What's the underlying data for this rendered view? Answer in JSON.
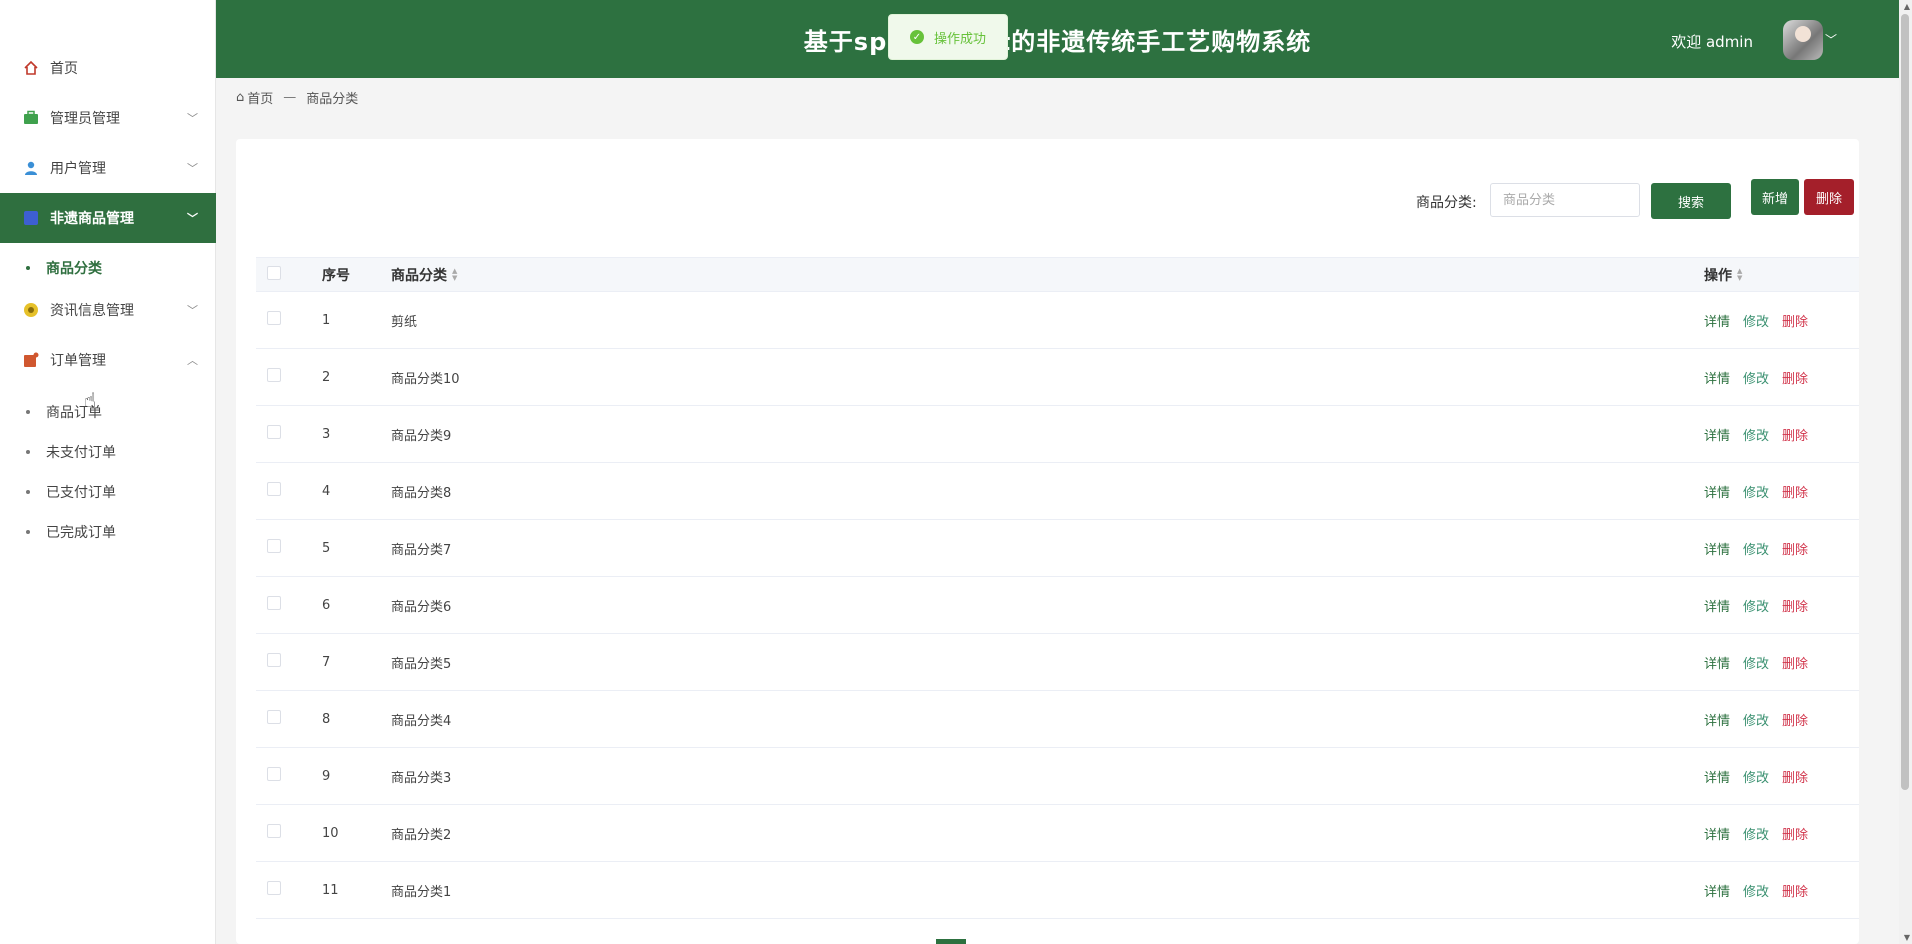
{
  "header": {
    "title": "基于springboot的非遗传统手工艺购物系统",
    "welcome": "欢迎 admin"
  },
  "toast": {
    "message": "操作成功"
  },
  "sidebar": {
    "items": [
      {
        "label": "首页",
        "icon": "home-icon"
      },
      {
        "label": "管理员管理",
        "icon": "briefcase-icon"
      },
      {
        "label": "用户管理",
        "icon": "user-icon"
      },
      {
        "label": "非遗商品管理",
        "icon": "box-icon"
      },
      {
        "label": "资讯信息管理",
        "icon": "coin-icon"
      },
      {
        "label": "订单管理",
        "icon": "order-icon"
      }
    ],
    "goods_sub": [
      "商品分类"
    ],
    "order_sub": [
      "商品订单",
      "未支付订单",
      "已支付订单",
      "已完成订单"
    ]
  },
  "breadcrumb": {
    "home": "首页",
    "sep": "—",
    "current": "商品分类"
  },
  "search": {
    "label": "商品分类:",
    "placeholder": "商品分类",
    "button": "搜索"
  },
  "actions": {
    "add": "新增",
    "delete": "删除"
  },
  "table": {
    "headers": {
      "index": "序号",
      "name": "商品分类",
      "ops": "操作"
    },
    "op_labels": {
      "detail": "详情",
      "edit": "修改",
      "del": "删除"
    },
    "rows": [
      {
        "index": "1",
        "name": "剪纸"
      },
      {
        "index": "2",
        "name": "商品分类10"
      },
      {
        "index": "3",
        "name": "商品分类9"
      },
      {
        "index": "4",
        "name": "商品分类8"
      },
      {
        "index": "5",
        "name": "商品分类7"
      },
      {
        "index": "6",
        "name": "商品分类6"
      },
      {
        "index": "7",
        "name": "商品分类5"
      },
      {
        "index": "8",
        "name": "商品分类4"
      },
      {
        "index": "9",
        "name": "商品分类3"
      },
      {
        "index": "10",
        "name": "商品分类2"
      },
      {
        "index": "11",
        "name": "商品分类1"
      }
    ]
  },
  "colors": {
    "primary": "#2d7140",
    "danger": "#a41f2a"
  }
}
